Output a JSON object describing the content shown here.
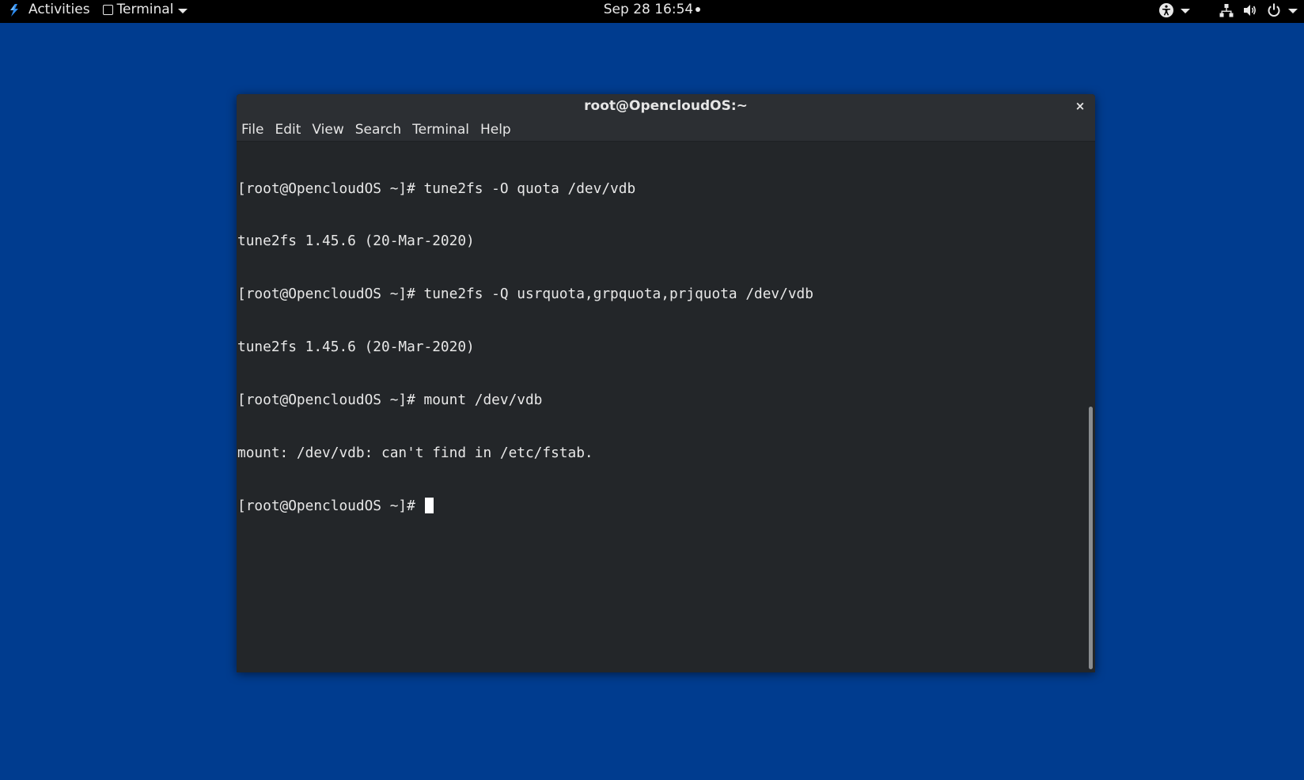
{
  "topbar": {
    "activities_label": "Activities",
    "app_menu_label": "Terminal",
    "clock": "Sep 28  16:54",
    "icons": [
      "distro-logo-icon",
      "accessibility-icon",
      "network-icon",
      "volume-icon",
      "power-icon"
    ]
  },
  "window": {
    "title": "root@OpencloudOS:~",
    "close_glyph": "×",
    "menu": [
      "File",
      "Edit",
      "View",
      "Search",
      "Terminal",
      "Help"
    ],
    "lines": [
      "[root@OpencloudOS ~]# tune2fs -O quota /dev/vdb",
      "tune2fs 1.45.6 (20-Mar-2020)",
      "[root@OpencloudOS ~]# tune2fs -Q usrquota,grpquota,prjquota /dev/vdb",
      "tune2fs 1.45.6 (20-Mar-2020)",
      "[root@OpencloudOS ~]# mount /dev/vdb",
      "mount: /dev/vdb: can't find in /etc/fstab.",
      "[root@OpencloudOS ~]# "
    ]
  },
  "colors": {
    "desktop": "#003c8f",
    "topbar": "#000000",
    "terminal_bg": "#232629",
    "terminal_fg": "#e8e8e8"
  }
}
